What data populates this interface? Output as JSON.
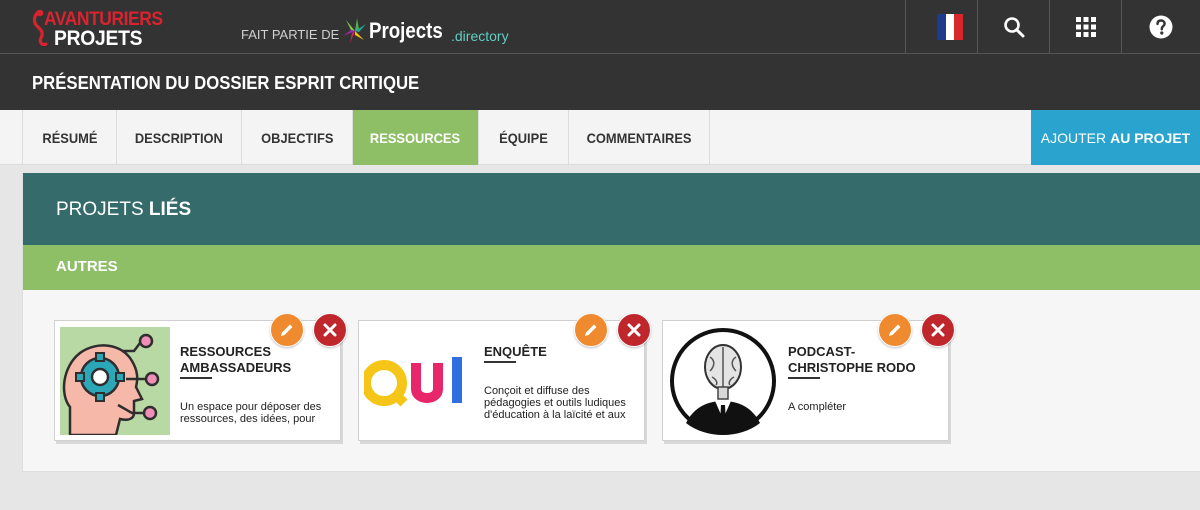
{
  "brand": {
    "logo_line1": "AVANTURIERS",
    "logo_line2": "PROJETS",
    "part_of": "FAIT PARTIE DE",
    "directory_main": "Projects",
    "directory_sub": ".directory"
  },
  "topnav": {
    "language": "French flag",
    "icons": [
      "search-icon",
      "apps-grid-icon",
      "help-icon"
    ]
  },
  "page": {
    "title": "PRÉSENTATION DU DOSSIER ESPRIT CRITIQUE"
  },
  "tabs": [
    {
      "label": "RÉSUMÉ",
      "active": false
    },
    {
      "label": "DESCRIPTION",
      "active": false
    },
    {
      "label": "OBJECTIFS",
      "active": false
    },
    {
      "label": "RESSOURCES",
      "active": true
    },
    {
      "label": "ÉQUIPE",
      "active": false
    },
    {
      "label": "COMMENTAIRES",
      "active": false
    }
  ],
  "actions": {
    "add_part1": "AJOUTER",
    "add_part2": "AU PROJET"
  },
  "section": {
    "title_part1": "PROJETS",
    "title_part2": "LIÉS",
    "subtitle": "AUTRES"
  },
  "cards": [
    {
      "name": "RESSOURCES AMBASSADEURS",
      "description": "Un espace pour déposer des ressources, des idées, pour",
      "thumb": "gear-head-illustration"
    },
    {
      "name": "ENQUÊTE",
      "description": "Conçoit et diffuse des pédagogies et outils ludiques d'éducation à la laïcité et aux",
      "thumb_text": "QUI"
    },
    {
      "name": "PODCAST- CHRISTOPHE RODO",
      "description": "A compléter",
      "thumb": "brain-head-suit-illustration"
    }
  ],
  "colors": {
    "topbar": "#333333",
    "accent_green": "#8ebf67",
    "section_teal": "#356b6a",
    "add_blue": "#2aa3cf",
    "edit_orange": "#f08a2e",
    "delete_red": "#c0272d"
  }
}
